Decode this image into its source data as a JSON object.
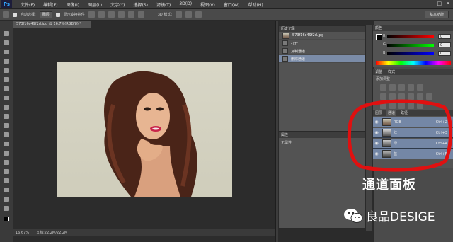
{
  "app": {
    "logo": "Ps"
  },
  "menubar": {
    "items": [
      "文件(F)",
      "编辑(E)",
      "图像(I)",
      "图层(L)",
      "文字(Y)",
      "选择(S)",
      "滤镜(T)",
      "3D(D)",
      "视图(V)",
      "窗口(W)",
      "帮助(H)"
    ],
    "window_buttons": [
      "—",
      "□",
      "✕"
    ]
  },
  "options": {
    "auto_select_label": "自动选择:",
    "layer_select": "图层",
    "show_transform": "显示变换控件",
    "mode_label": "3D 模式:",
    "workspace": "基本功能"
  },
  "document": {
    "tab_title": "573f16c49f2d.jpg @ 16.7%(RGB/8) *",
    "status": "文档:22.2M/22.2M",
    "zoom": "16.67%"
  },
  "history": {
    "header": "历史记录",
    "snapshot": "573f16c49f2d.jpg",
    "items": [
      "打开",
      "复制通道",
      "删除通道"
    ],
    "selected_index": 2
  },
  "properties": {
    "header": "属性",
    "content": "无属性"
  },
  "color": {
    "header": "颜色",
    "r": "0",
    "g": "0",
    "b": "0"
  },
  "adjustments": {
    "header": "调整",
    "tab2": "样式",
    "add_label": "添加调整"
  },
  "channels": {
    "tabs": [
      "图层",
      "通道",
      "路径"
    ],
    "active_tab": "通道",
    "rows": [
      {
        "name": "RGB",
        "shortcut": "Ctrl+2"
      },
      {
        "name": "红",
        "shortcut": "Ctrl+3"
      },
      {
        "name": "绿",
        "shortcut": "Ctrl+4"
      },
      {
        "name": "蓝",
        "shortcut": "Ctrl+5"
      }
    ]
  },
  "overlay": {
    "caption": "通道面板",
    "watermark": "良品DESIGE"
  },
  "colors": {
    "highlight_circle": "#e01010",
    "selected_row": "#7487a6"
  }
}
